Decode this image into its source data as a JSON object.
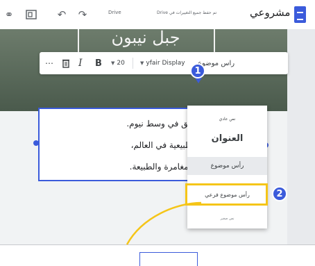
{
  "header": {
    "title": "مشروعي",
    "saved_status": "تم حفظ جميع التغييرات في Drive",
    "drive_label": "Drive"
  },
  "hero": {
    "text": "جبل نيبون"
  },
  "toolbar": {
    "more_label": "⋯",
    "italic_label": "I",
    "bold_label": "B",
    "font_size": "20",
    "font_family": "yfair Display",
    "style_label": "راس موضوع"
  },
  "textbox": {
    "lines": [
      "بينا، ذلك الجبل الشاهق في وسط نيوم.",
      "من أجمل المناظر الطبيعية في العالم،",
      "زة لمن يستمتعون بالمغامرة والطبيعة."
    ]
  },
  "dropdown": {
    "items": [
      "نص عادي",
      "العنوان",
      "رأس موضوع",
      "رأس موضوع فرعي",
      "نص صغير"
    ],
    "highlighted_index": 3
  },
  "callouts": [
    "1",
    "2"
  ],
  "colors": {
    "accent": "#3b5bdb",
    "highlight": "#f5c518"
  }
}
